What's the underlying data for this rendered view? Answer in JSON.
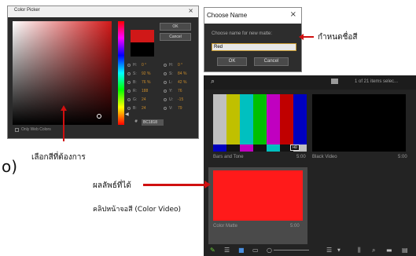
{
  "color_picker": {
    "title": "Color Picker",
    "close": "×",
    "ok_label": "OK",
    "cancel_label": "Cancel",
    "selected_color": "#d01818",
    "previous_color": "#000000",
    "values": [
      {
        "mode": "H:",
        "value": "0 °",
        "mode2": "H:",
        "value2": "0 °"
      },
      {
        "mode": "S:",
        "value": "92 %",
        "mode2": "S:",
        "value2": "84 %"
      },
      {
        "mode": "B:",
        "value": "76 %",
        "mode2": "L:",
        "value2": "42 %"
      },
      {
        "mode": "R:",
        "value": "188",
        "mode2": "Y:",
        "value2": "76"
      },
      {
        "mode": "G:",
        "value": "24",
        "mode2": "U:",
        "value2": "-15"
      },
      {
        "mode": "B:",
        "value": "24",
        "mode2": "V:",
        "value2": "79"
      }
    ],
    "hash": "#",
    "hex_value": "BC1818",
    "web_colors_label": "Only Web Colors"
  },
  "choose_name": {
    "title": "Choose Name",
    "close": "×",
    "prompt": "Choose name for new matte:",
    "input_value": "Red",
    "ok_label": "OK",
    "cancel_label": "Cancel"
  },
  "project_panel": {
    "search_icon": "⌕",
    "item_count": "1 of 21 items selec...",
    "bar_colors": [
      "#c0c0c0",
      "#c0c000",
      "#00c0c0",
      "#00c000",
      "#c000c0",
      "#c00000",
      "#0000c0"
    ],
    "bar_bottom_colors": [
      "#0000c0",
      "#131313",
      "#c000c0",
      "#131313",
      "#00c0c0",
      "#131313",
      "#c0c0c0"
    ],
    "hd_badge": "HD",
    "clips": [
      {
        "name": "Bars and Tone",
        "duration": "5:00"
      },
      {
        "name": "Black Video",
        "duration": "5:00"
      },
      {
        "name": "Color Matte",
        "duration": "5:00"
      }
    ],
    "matte_color": "#ff1a1a"
  },
  "annotations": {
    "name_label": "กำหนดชื่อสี",
    "choose_color": "เลือกสีที่ต้องการ",
    "result": "ผลลัพธ์ที่ได้",
    "clip_type": "คลิปหน้าจอสี (Color Video)",
    "left_fragment": "o)"
  }
}
